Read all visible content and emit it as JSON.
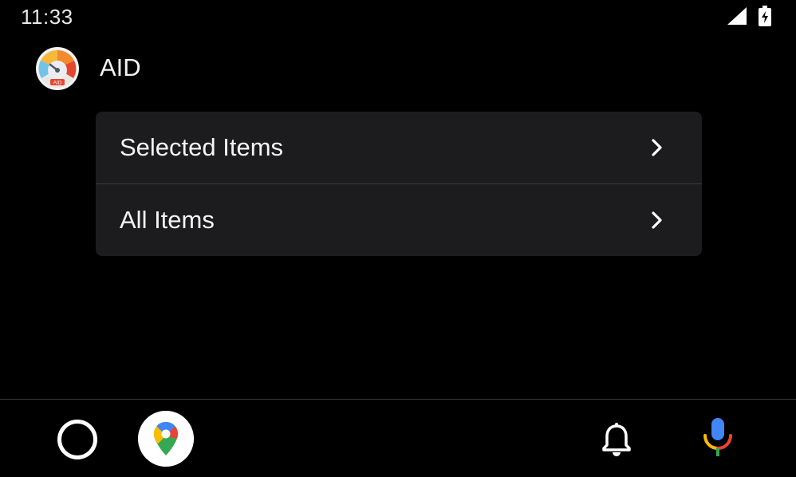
{
  "status_bar": {
    "time": "11:33",
    "signal_icon": "signal-icon",
    "battery_icon": "battery-charging-icon"
  },
  "header": {
    "app_title": "AID",
    "logo_text": "AID",
    "logo_icon": "speedometer-logo"
  },
  "menu": {
    "items": [
      {
        "label": "Selected Items",
        "icon": "chevron-right-icon"
      },
      {
        "label": "All Items",
        "icon": "chevron-right-icon"
      }
    ]
  },
  "bottom_bar": {
    "home_icon": "home-circle-icon",
    "maps_icon": "google-maps-icon",
    "notification_icon": "bell-icon",
    "voice_icon": "microphone-icon"
  },
  "colors": {
    "background": "#000000",
    "card": "#1c1c1f",
    "divider": "#3a3a3d",
    "text": "#f4f4f4"
  }
}
